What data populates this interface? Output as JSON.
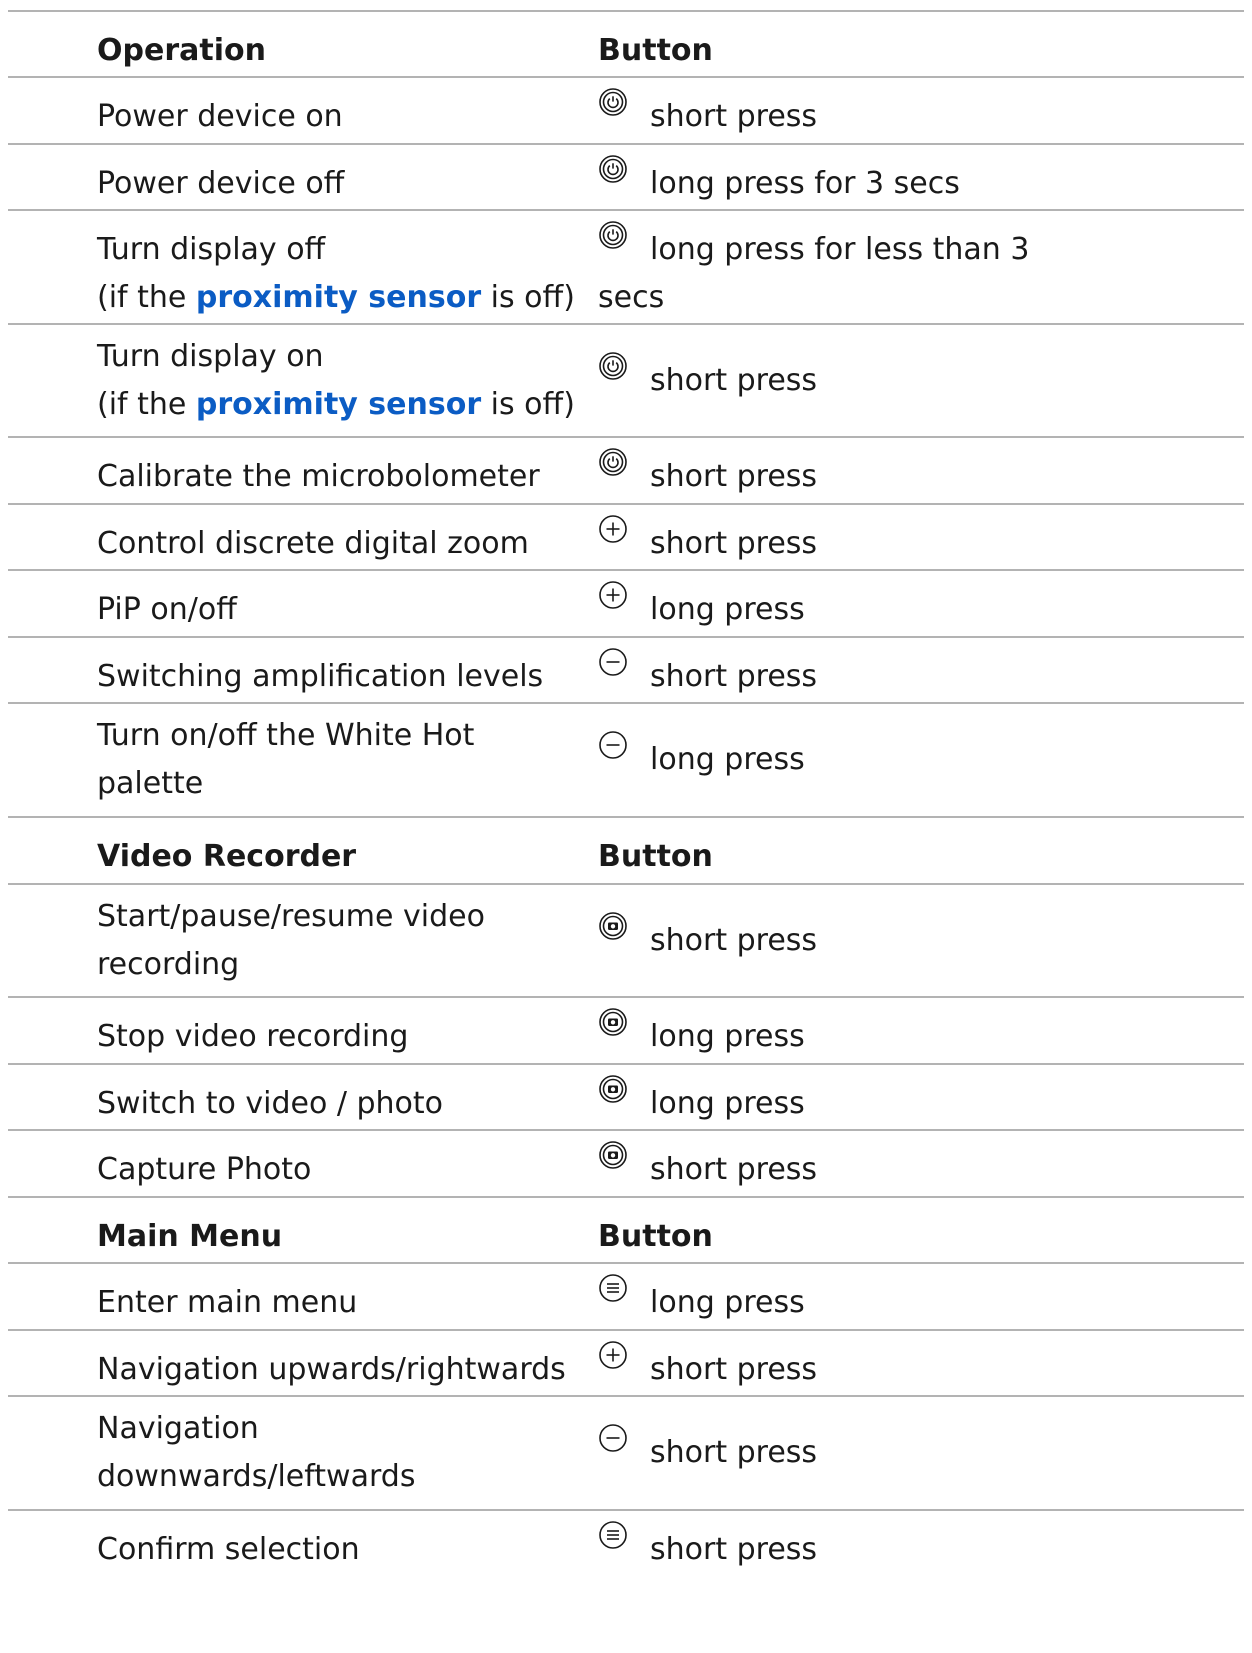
{
  "headers": {
    "operation": {
      "op": "Operation",
      "btn": "Button"
    },
    "video": {
      "op": "Video Recorder",
      "btn": "Button"
    },
    "menu": {
      "op": "Main Menu",
      "btn": "Button"
    }
  },
  "rows": [
    {
      "op": "Power device on",
      "icon": "power-icon",
      "action": "short press"
    },
    {
      "op": "Power device off",
      "icon": "power-icon",
      "action": "long press for 3 secs"
    },
    {
      "op_line1": "Turn display off",
      "op_pre": "(if the ",
      "op_link": "proximity sensor",
      "op_post": " is off)",
      "icon": "power-icon",
      "action_line1": "long press for less than 3",
      "action_line2": "secs"
    },
    {
      "op_line1": "Turn display on",
      "op_pre": "(if the ",
      "op_link": "proximity sensor",
      "op_post": " is off)",
      "icon": "power-icon",
      "action": "short press"
    },
    {
      "op": "Calibrate the microbolometer",
      "icon": "power-icon",
      "action": "short press"
    },
    {
      "op": "Control discrete digital zoom",
      "icon": "plus-icon",
      "action": "short press"
    },
    {
      "op": "PiP on/off",
      "icon": "plus-icon",
      "action": "long press"
    },
    {
      "op": "Switching amplification levels",
      "icon": "minus-icon",
      "action": "short press"
    },
    {
      "op_line1": "Turn on/off the White Hot",
      "op_line2": "palette",
      "icon": "minus-icon",
      "action": "long press"
    },
    {
      "op_line1": "Start/pause/resume video",
      "op_line2": "recording",
      "icon": "camera-icon",
      "action": "short press"
    },
    {
      "op": "Stop video recording",
      "icon": "camera-icon",
      "action": "long press"
    },
    {
      "op": "Switch to video / photo",
      "icon": "camera-icon",
      "action": "long press"
    },
    {
      "op": "Capture Photo",
      "icon": "camera-icon",
      "action": "short press"
    },
    {
      "op": "Enter main menu",
      "icon": "menu-icon",
      "action": "long press"
    },
    {
      "op": "Navigation upwards/rightwards",
      "icon": "plus-icon",
      "action": "short press"
    },
    {
      "op_line1": "Navigation",
      "op_line2": "downwards/leftwards",
      "icon": "minus-icon",
      "action": "short press"
    },
    {
      "op": "Confirm selection",
      "icon": "menu-icon",
      "action": "short press"
    }
  ],
  "colors": {
    "link": "#0b5cc4",
    "rule": "#b3b3b3",
    "text": "#1a1a1a"
  }
}
